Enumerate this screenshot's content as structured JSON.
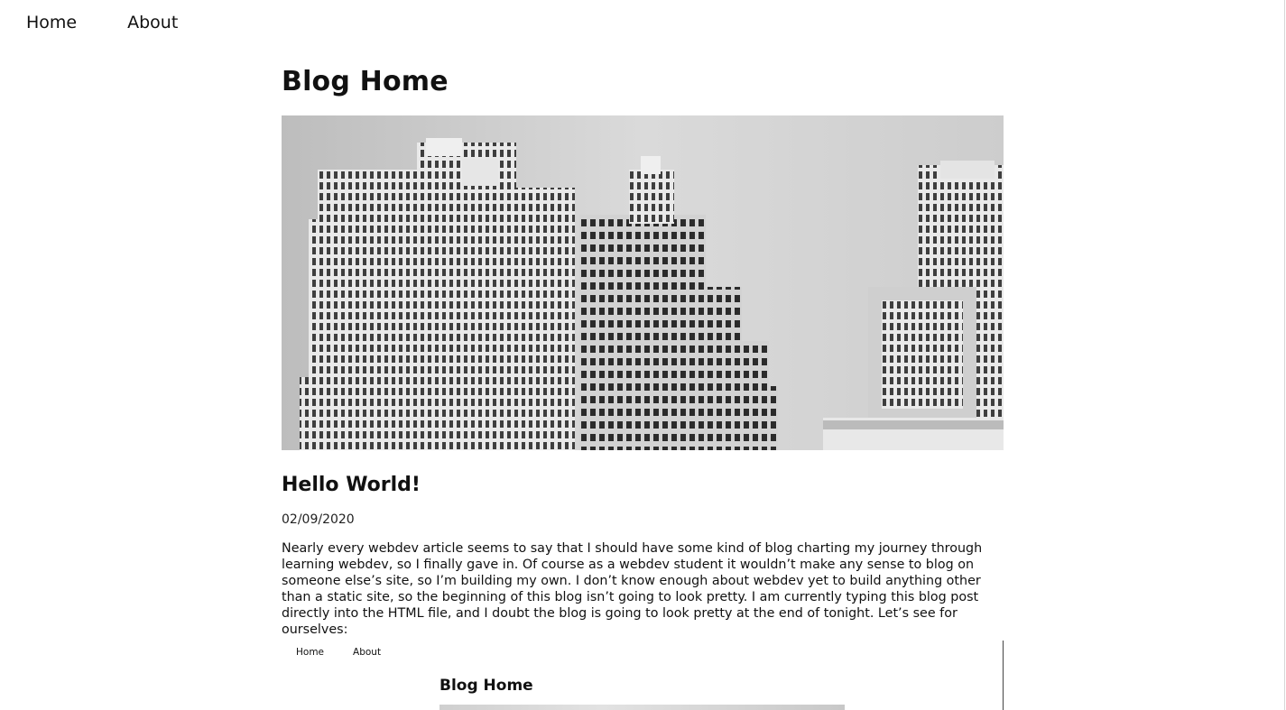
{
  "nav": {
    "home_label": "Home",
    "about_label": "About"
  },
  "main": {
    "page_title": "Blog Home",
    "hero_image_alt": "black-and-white-city-skyline-icon",
    "post": {
      "title": "Hello World!",
      "date": "02/09/2020",
      "body": "Nearly every webdev article seems to say that I should have some kind of blog charting my journey through learning webdev, so I finally gave in. Of course as a webdev student it wouldn’t make any sense to blog on someone else’s site, so I’m building my own. I don’t know enough about webdev yet to build anything other than a static site, so the beginning of this blog isn’t going to look pretty. I am currently typing this blog post directly into the HTML file, and I doubt the blog is going to look pretty at the end of tonight. Let’s see for ourselves:"
    },
    "embedded_screenshot": {
      "nav_home": "Home",
      "nav_about": "About",
      "title": "Blog Home"
    }
  }
}
